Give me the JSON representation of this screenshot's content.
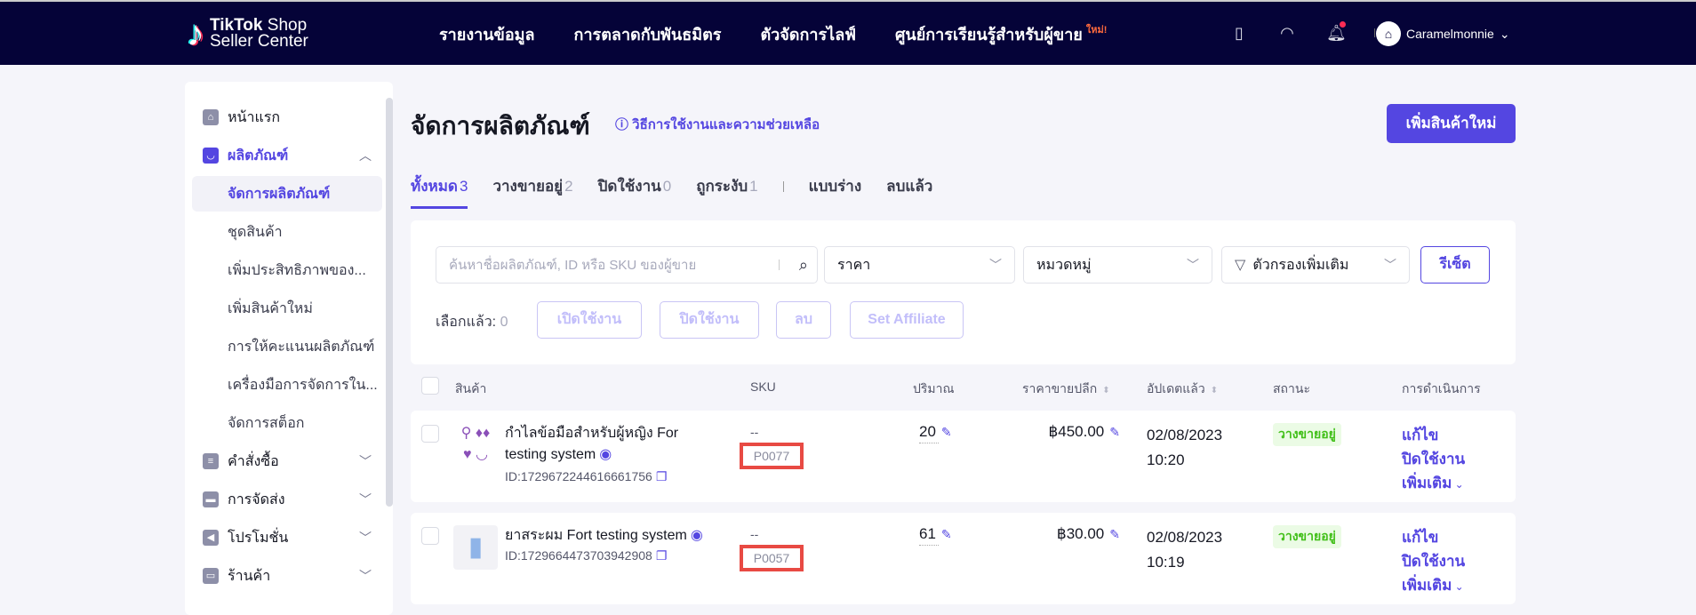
{
  "header": {
    "logo_brand": "TikTok",
    "logo_shop": "Shop",
    "logo_sub": "Seller Center",
    "nav": [
      {
        "label": "รายงานข้อมูล"
      },
      {
        "label": "การตลาดกับพันธมิตร"
      },
      {
        "label": "ตัวจัดการไลฟ์"
      },
      {
        "label": "ศูนย์การเรียนรู้สำหรับผู้ขาย",
        "badge": "ใหม่!"
      }
    ],
    "icons": [
      "phone-icon",
      "headset-icon",
      "bell-icon"
    ],
    "username": "Caramelmonnie"
  },
  "sidebar": {
    "items": [
      {
        "label": "หน้าแรก",
        "icon": "home-icon"
      },
      {
        "label": "ผลิตภัณฑ์",
        "icon": "bag-icon",
        "expanded": true
      },
      {
        "label": "จัดการผลิตภัณฑ์",
        "active": true
      },
      {
        "label": "ชุดสินค้า"
      },
      {
        "label": "เพิ่มประสิทธิภาพของ..."
      },
      {
        "label": "เพิ่มสินค้าใหม่"
      },
      {
        "label": "การให้คะแนนผลิตภัณฑ์"
      },
      {
        "label": "เครื่องมือการจัดการใน..."
      },
      {
        "label": "จัดการสต็อก"
      },
      {
        "label": "คำสั่งซื้อ",
        "icon": "document-icon"
      },
      {
        "label": "การจัดส่ง",
        "icon": "truck-icon"
      },
      {
        "label": "โปรโมชั่น",
        "icon": "megaphone-icon"
      },
      {
        "label": "ร้านค้า",
        "icon": "store-icon"
      }
    ]
  },
  "main": {
    "title": "จัดการผลิตภัณฑ์",
    "help_link": "วิธีการใช้งานและความช่วยเหลือ",
    "add_button": "เพิ่มสินค้าใหม่",
    "tabs": [
      {
        "label": "ทั้งหมด",
        "count": "3",
        "active": true
      },
      {
        "label": "วางขายอยู่",
        "count": "2"
      },
      {
        "label": "ปิดใช้งาน",
        "count": "0"
      },
      {
        "label": "ถูกระงับ",
        "count": "1"
      },
      {
        "label": "แบบร่าง",
        "count": ""
      },
      {
        "label": "ลบแล้ว",
        "count": ""
      }
    ],
    "filters": {
      "search_placeholder": "ค้นหาชื่อผลิตภัณฑ์, ID หรือ SKU ของผู้ขาย",
      "price": "ราคา",
      "category": "หมวดหมู่",
      "more_filters": "ตัวกรองเพิ่มเติม",
      "reset": "รีเซ็ต"
    },
    "bulk": {
      "selected_label": "เลือกแล้ว:",
      "selected_count": "0",
      "activate": "เปิดใช้งาน",
      "deactivate": "ปิดใช้งาน",
      "delete": "ลบ",
      "set_affiliate": "Set Affiliate"
    },
    "table": {
      "columns": [
        "สินค้า",
        "SKU",
        "ปริมาณ",
        "ราคาขายปลีก",
        "อัปเดตแล้ว",
        "สถานะ",
        "การดำเนินการ"
      ],
      "rows": [
        {
          "name": "กำไลข้อมือสำหรับผู้หญิง For testing system",
          "id": "ID:1729672244616661756",
          "sku_top": "--",
          "sku": "P0077",
          "quantity": "20",
          "price": "฿450.00",
          "updated_date": "02/08/2023",
          "updated_time": "10:20",
          "status": "วางขายอยู่",
          "actions": [
            "แก้ไข",
            "ปิดใช้งาน",
            "เพิ่มเติม"
          ]
        },
        {
          "name": "ยาสระผม Fort testing system",
          "id": "ID:1729664473703942908",
          "sku_top": "--",
          "sku": "P0057",
          "quantity": "61",
          "price": "฿30.00",
          "updated_date": "02/08/2023",
          "updated_time": "10:19",
          "status": "วางขายอยู่",
          "actions": [
            "แก้ไข",
            "ปิดใช้งาน",
            "เพิ่มเติม"
          ]
        }
      ]
    }
  },
  "colors": {
    "brand": "#5446e1",
    "topbar": "#050338",
    "status_green": "#40bf17",
    "highlight": "#e84a43"
  }
}
